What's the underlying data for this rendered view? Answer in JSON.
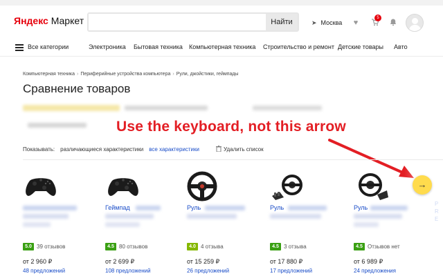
{
  "header": {
    "logo_red": "Яндекс",
    "logo_black": "Маркет",
    "search_placeholder": "",
    "search_button": "Найти",
    "region": "Москва",
    "cart_count": "5"
  },
  "nav": {
    "all_categories": "Все категории",
    "items": [
      "Электроника",
      "Бытовая техника",
      "Компьютерная техника",
      "Строительство и ремонт",
      "Детские товары",
      "Авто"
    ]
  },
  "breadcrumb": [
    "Компьютерная техника",
    "Периферийные устройства компьютера",
    "Рули, джойстики, геймпады"
  ],
  "page_title": "Сравнение товаров",
  "annotation": "Use the keyboard, not this arrow",
  "filters": {
    "label": "Показывать:",
    "option_diff": "различающиеся характеристики",
    "option_all": "все характеристики",
    "clear": "Удалить список"
  },
  "products": [
    {
      "name": "",
      "rating": "5.0",
      "rating_color": "#3aa013",
      "reviews": "39 отзывов",
      "price": "от 2 960 ₽",
      "offers": "48 предложений",
      "icon": "gamepad-icon"
    },
    {
      "name": "Геймпад",
      "rating": "4.5",
      "rating_color": "#3aa013",
      "reviews": "80 отзывов",
      "price": "от 2 699 ₽",
      "offers": "108 предложений",
      "icon": "gamepad-icon"
    },
    {
      "name": "Руль",
      "rating": "4.0",
      "rating_color": "#85b800",
      "reviews": "4 отзыва",
      "price": "от 15 259 ₽",
      "offers": "26 предложений",
      "icon": "steering-wheel-icon"
    },
    {
      "name": "Руль",
      "rating": "4.5",
      "rating_color": "#3aa013",
      "reviews": "3 отзыва",
      "price": "от 17 880 ₽",
      "offers": "17 предложений",
      "icon": "steering-wheel-pedals-icon"
    },
    {
      "name": "Руль",
      "rating": "4.5",
      "rating_color": "#3aa013",
      "reviews": "Отзывов нет",
      "price": "от 6 989 ₽",
      "offers": "24 предложения",
      "icon": "steering-wheel-icon"
    }
  ],
  "next_button_icon": "arrow-right-icon",
  "edge_column_fragment": [
    "Р",
    "R",
    "E"
  ]
}
